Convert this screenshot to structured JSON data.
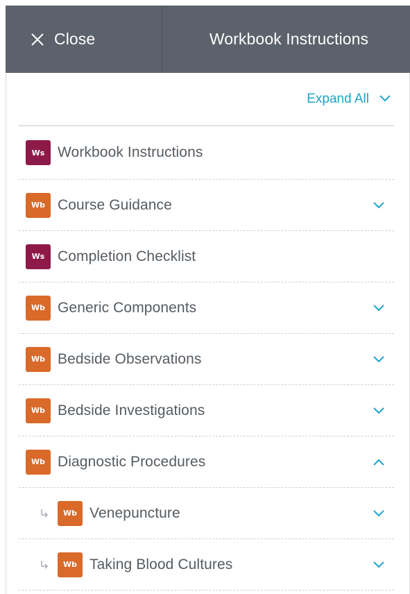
{
  "header": {
    "close_label": "Close",
    "close_icon": "close-icon",
    "title": "Workbook Instructions"
  },
  "toolbar": {
    "expand_all_label": "Expand All",
    "expand_icon": "chevron-down-icon"
  },
  "colors": {
    "topbar": "#5c626b",
    "accent": "#1ea3c9",
    "ws_badge": "#8e1a4a",
    "wb_badge": "#d96a2a",
    "text": "#555b61"
  },
  "items": [
    {
      "badge": "Ws",
      "label": "Workbook Instructions",
      "chevron": "none"
    },
    {
      "badge": "Wb",
      "label": "Course Guidance",
      "chevron": "down"
    },
    {
      "badge": "Ws",
      "label": "Completion Checklist",
      "chevron": "none"
    },
    {
      "badge": "Wb",
      "label": "Generic Components",
      "chevron": "down"
    },
    {
      "badge": "Wb",
      "label": "Bedside Observations",
      "chevron": "down"
    },
    {
      "badge": "Wb",
      "label": "Bedside Investigations",
      "chevron": "down"
    },
    {
      "badge": "Wb",
      "label": "Diagnostic Procedures",
      "chevron": "up"
    },
    {
      "badge": "Wb",
      "label": "Venepuncture",
      "chevron": "down",
      "child": true
    },
    {
      "badge": "Wb",
      "label": "Taking Blood Cultures",
      "chevron": "down",
      "child": true
    }
  ]
}
